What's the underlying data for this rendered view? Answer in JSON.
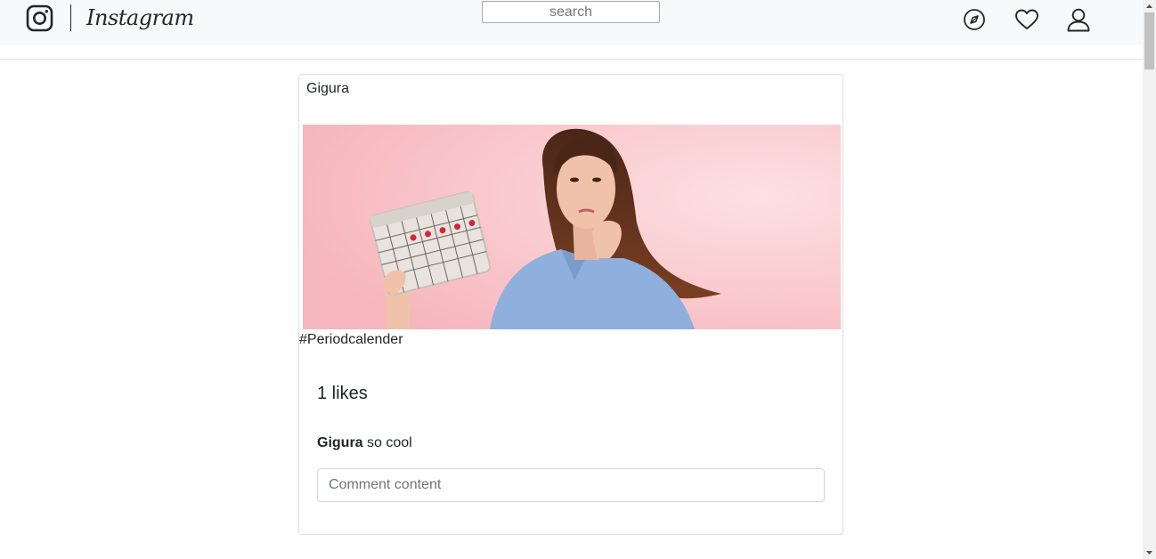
{
  "header": {
    "brand": "Instagram",
    "search_placeholder": "search",
    "icons": [
      "instagram-logo-icon",
      "compass-icon",
      "heart-icon",
      "user-icon"
    ]
  },
  "post": {
    "username": "Gigura",
    "caption": "#Periodcalender",
    "likes": "1 likes",
    "comments": [
      {
        "author": "Gigura",
        "text": " so cool"
      }
    ],
    "comment_placeholder": "Comment content"
  },
  "colors": {
    "navbar_bg": "#f8f9fa",
    "photo_bg": "#f7b9c0",
    "shirt": "#8fb0dc"
  }
}
